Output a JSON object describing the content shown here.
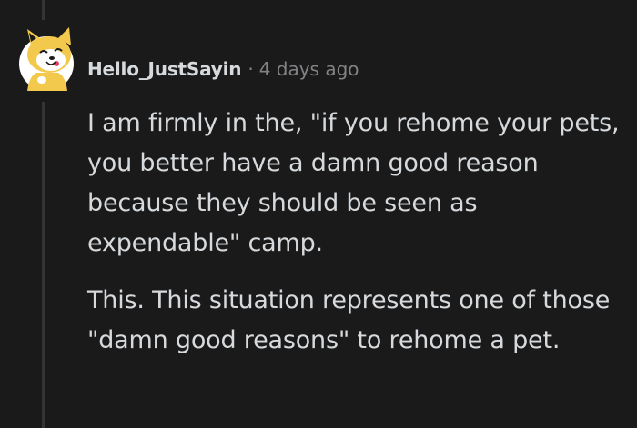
{
  "comment": {
    "username": "Hello_JustSayin",
    "separator": "·",
    "timestamp": "4 days ago",
    "avatar_icon": "shiba-dog-avatar-icon",
    "paragraphs": [
      "I am firmly in the, \"if you rehome your pets, you better have a damn good reason because they should be seen as expendable\" camp.",
      "This. This situation represents one of those \"damn good reasons\" to rehome a pet."
    ]
  },
  "colors": {
    "background": "#1a1a1b",
    "thread_line": "#343536",
    "text_primary": "#d7dadc",
    "text_meta": "#818384",
    "avatar_body": "#f2c94c"
  }
}
